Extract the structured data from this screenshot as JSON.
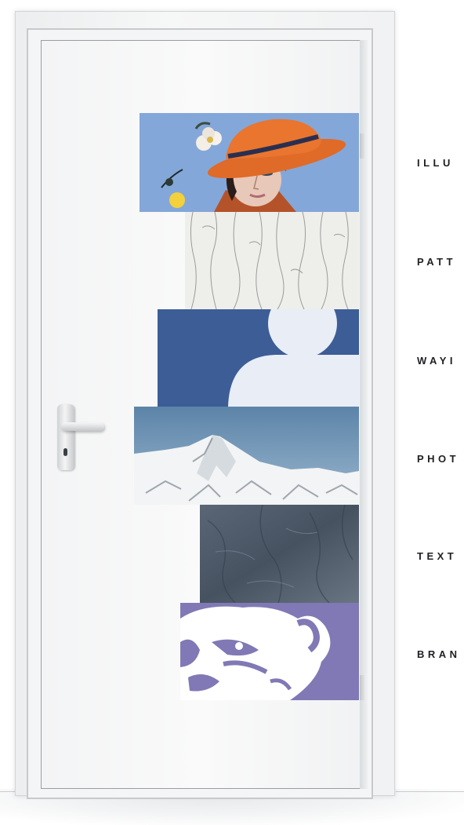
{
  "categories": [
    {
      "label": "ILLU"
    },
    {
      "label": "PATT"
    },
    {
      "label": "WAYI"
    },
    {
      "label": "PHOT"
    },
    {
      "label": "TEXT"
    },
    {
      "label": "BRAN"
    }
  ],
  "tiles": [
    {
      "name": "illustration",
      "icon": "woman-in-hat-illustration",
      "color": "#7aa0d6"
    },
    {
      "name": "pattern",
      "icon": "wavy-line-pattern",
      "color": "#eeeeeb"
    },
    {
      "name": "wayfinding",
      "icon": "person-pictogram",
      "color": "#3d5d96"
    },
    {
      "name": "photography",
      "icon": "snowy-mountain-photo",
      "color": "#6e8fae"
    },
    {
      "name": "texture",
      "icon": "stone-texture",
      "color": "#4a5564"
    },
    {
      "name": "branding",
      "icon": "bear-logo",
      "color": "#8079b5"
    }
  ]
}
